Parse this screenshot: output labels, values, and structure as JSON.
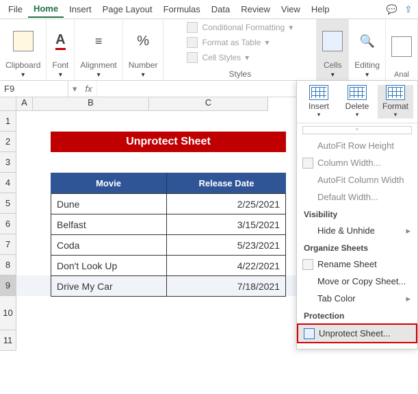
{
  "menubar": {
    "items": [
      "File",
      "Home",
      "Insert",
      "Page Layout",
      "Formulas",
      "Data",
      "Review",
      "View",
      "Help"
    ],
    "active_index": 1
  },
  "ribbon": {
    "clipboard_label": "Clipboard",
    "font_label": "Font",
    "alignment_label": "Alignment",
    "number_label": "Number",
    "styles_label": "Styles",
    "cells_label": "Cells",
    "editing_label": "Editing",
    "analysis_label": "Analyze Data",
    "cond_fmt": "Conditional Formatting",
    "fmt_table": "Format as Table",
    "cell_styles": "Cell Styles"
  },
  "namebox": {
    "value": "F9",
    "fx": "fx"
  },
  "columns": [
    "A",
    "B",
    "C"
  ],
  "rows": [
    "1",
    "2",
    "3",
    "4",
    "5",
    "6",
    "7",
    "8",
    "9",
    "10",
    "11"
  ],
  "banner": "Unprotect Sheet",
  "table": {
    "headers": [
      "Movie",
      "Release Date"
    ],
    "rows": [
      {
        "movie": "Dune",
        "date": "2/25/2021"
      },
      {
        "movie": "Belfast",
        "date": "3/15/2021"
      },
      {
        "movie": "Coda",
        "date": "5/23/2021"
      },
      {
        "movie": "Don't Look Up",
        "date": "4/22/2021"
      },
      {
        "movie": "Drive My Car",
        "date": "7/18/2021"
      }
    ]
  },
  "format_menu": {
    "insert": "Insert",
    "delete": "Delete",
    "format": "Format",
    "autofit_row": "AutoFit Row Height",
    "col_width": "Column Width...",
    "autofit_col": "AutoFit Column Width",
    "default_width": "Default Width...",
    "visibility": "Visibility",
    "hide_unhide": "Hide & Unhide",
    "organize": "Organize Sheets",
    "rename": "Rename Sheet",
    "move_copy": "Move or Copy Sheet...",
    "tab_color": "Tab Color",
    "protection": "Protection",
    "unprotect": "Unprotect Sheet..."
  }
}
